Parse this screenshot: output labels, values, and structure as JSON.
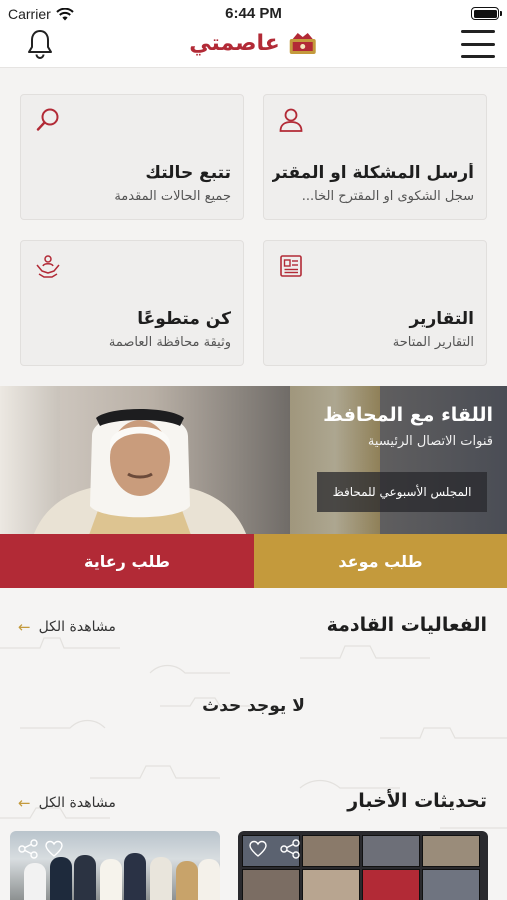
{
  "status": {
    "carrier": "Carrier",
    "time": "6:44 PM"
  },
  "navbar": {
    "logo_text": "عاصمتي"
  },
  "cards": [
    {
      "title": "تتبع حالتك",
      "subtitle": "جميع الحالات المقدمة",
      "icon": "search-icon"
    },
    {
      "title": "أرسل المشكلة او المقترح ا...",
      "subtitle": "سجل الشكوى او المقترح الخا...",
      "icon": "user-icon"
    },
    {
      "title": "كن متطوعًا",
      "subtitle": "وثيقة محافظة العاصمة",
      "icon": "volunteer-icon"
    },
    {
      "title": "التقارير",
      "subtitle": "التقارير المتاحة",
      "icon": "report-icon"
    }
  ],
  "banner": {
    "title": "اللقاء مع المحافظ",
    "subtitle": "قنوات الاتصال الرئيسية",
    "button": "المجلس الأسبوعي للمحافظ"
  },
  "actions": {
    "sponsorship": "طلب رعاية",
    "appointment": "طلب موعد"
  },
  "events": {
    "title": "الفعاليات القادمة",
    "view_all": "مشاهدة الكل",
    "empty": "لا يوجد حدث"
  },
  "news": {
    "title": "تحديثات الأخبار",
    "view_all": "مشاهدة الكل"
  },
  "colors": {
    "brand_red": "#b22a36",
    "brand_gold": "#c49a3c"
  }
}
